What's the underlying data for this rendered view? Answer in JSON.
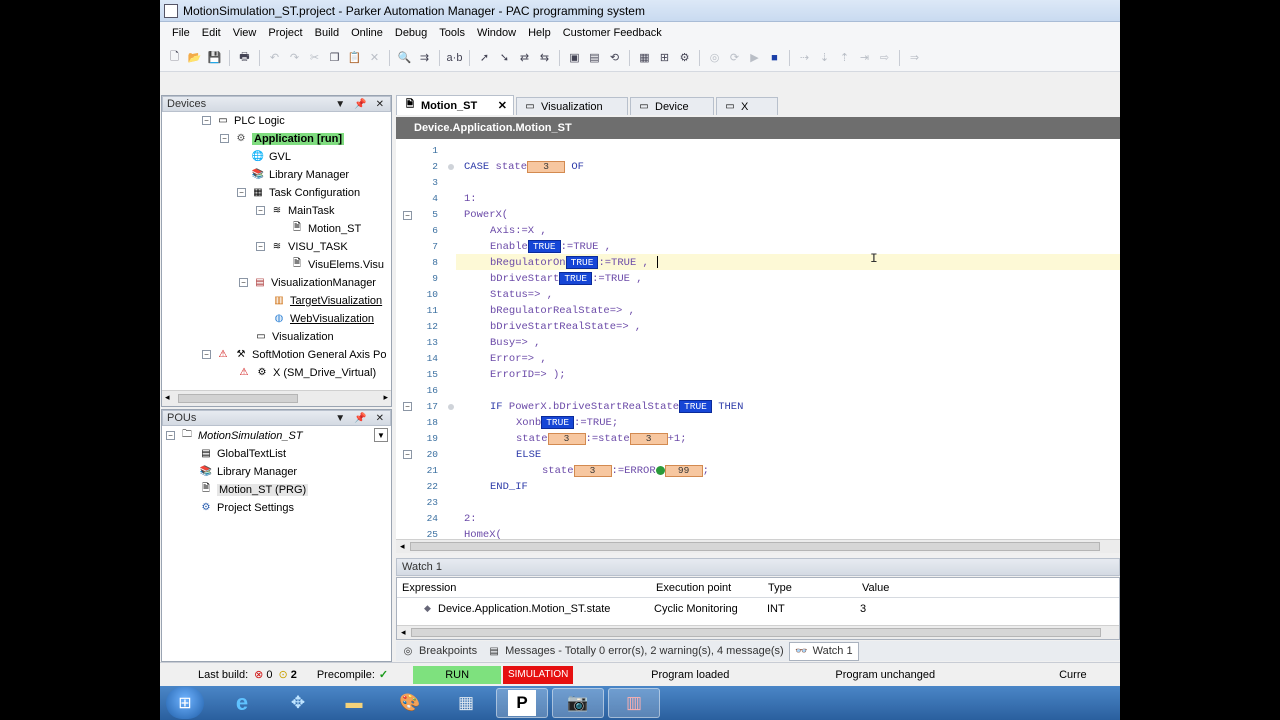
{
  "window": {
    "title": "MotionSimulation_ST.project - Parker Automation Manager - PAC programming system"
  },
  "menu": [
    "File",
    "Edit",
    "View",
    "Project",
    "Build",
    "Online",
    "Debug",
    "Tools",
    "Window",
    "Help",
    "Customer Feedback"
  ],
  "devices_panel": {
    "title": "Devices",
    "rows": [
      {
        "label": "PLC Logic",
        "icon": "plc-logic-icon"
      },
      {
        "label": "Application [run]",
        "icon": "application-gear-icon"
      },
      {
        "label": "GVL",
        "icon": "gvl-globe-icon"
      },
      {
        "label": "Library Manager",
        "icon": "library-books-icon"
      },
      {
        "label": "Task Configuration",
        "icon": "task-config-icon"
      },
      {
        "label": "MainTask",
        "icon": "task-icon"
      },
      {
        "label": "Motion_ST",
        "icon": "pou-icon"
      },
      {
        "label": "VISU_TASK",
        "icon": "task-icon"
      },
      {
        "label": "VisuElems.Visu",
        "icon": "pou-icon"
      },
      {
        "label": "VisualizationManager",
        "icon": "visu-manager-icon"
      },
      {
        "label": "TargetVisualization",
        "icon": "target-visu-icon"
      },
      {
        "label": "WebVisualization",
        "icon": "web-visu-icon"
      },
      {
        "label": "Visualization",
        "icon": "visualization-icon"
      },
      {
        "label": "SoftMotion General Axis Po",
        "icon": "warning-triangle-icon"
      },
      {
        "label": "X (SM_Drive_Virtual)",
        "icon": "axis-drive-icon"
      }
    ]
  },
  "pous_panel": {
    "title": "POUs",
    "rows": [
      {
        "label": "MotionSimulation_ST"
      },
      {
        "label": "GlobalTextList"
      },
      {
        "label": "Library Manager"
      },
      {
        "label": "Motion_ST (PRG)"
      },
      {
        "label": "Project Settings"
      }
    ]
  },
  "editor": {
    "tabs": [
      "Motion_ST",
      "Visualization",
      "Device",
      "X"
    ],
    "path": "Device.Application.Motion_ST",
    "lines": [
      {
        "n": "1",
        "code": ""
      },
      {
        "n": "2",
        "code": "CASE state [3] OF"
      },
      {
        "n": "3",
        "code": ""
      },
      {
        "n": "4",
        "code": "1:"
      },
      {
        "n": "5",
        "code": "PowerX("
      },
      {
        "n": "6",
        "code": "Axis:=X ,"
      },
      {
        "n": "7",
        "code": "Enable [TRUE] :=TRUE ,"
      },
      {
        "n": "8",
        "code": "bRegulatorOn [TRUE] :=TRUE ,"
      },
      {
        "n": "9",
        "code": "bDriveStart [TRUE] :=TRUE ,"
      },
      {
        "n": "10",
        "code": "Status=> ,"
      },
      {
        "n": "11",
        "code": "bRegulatorRealState=> ,"
      },
      {
        "n": "12",
        "code": "bDriveStartRealState=> ,"
      },
      {
        "n": "13",
        "code": "Busy=> ,"
      },
      {
        "n": "14",
        "code": "Error=> ,"
      },
      {
        "n": "15",
        "code": "ErrorID=> );"
      },
      {
        "n": "16",
        "code": ""
      },
      {
        "n": "17",
        "code": "IF PowerX.bDriveStartRealState [TRUE] THEN"
      },
      {
        "n": "18",
        "code": "Xonb [TRUE] :=TRUE;"
      },
      {
        "n": "19",
        "code": "state [3] :=state [3] +1;"
      },
      {
        "n": "20",
        "code": "ELSE"
      },
      {
        "n": "21",
        "code": "state [3] :=ERROR [99] ;"
      },
      {
        "n": "22",
        "code": "END_IF"
      },
      {
        "n": "23",
        "code": ""
      },
      {
        "n": "24",
        "code": "2:"
      },
      {
        "n": "25",
        "code": "HomeX("
      }
    ],
    "inline": {
      "true": "TRUE",
      "three": "3",
      "ninety_nine": "99"
    },
    "tokens": {
      "case": "CASE",
      "state": "state",
      "of": "OF",
      "one": "1:",
      "powerx": "PowerX(",
      "axis": "Axis:=X ,",
      "enable": "Enable",
      ":=true_comma": ":=TRUE ,",
      "breg": "bRegulatorOn",
      "bdrive": "bDriveStart",
      "status": "Status=> ,",
      "bregreal": "bRegulatorRealState=> ,",
      "bdrivereal": "bDriveStartRealState=> ,",
      "busy": "Busy=> ,",
      "error": "Error=> ,",
      "errorid": "ErrorID=> );",
      "if": "IF",
      "ifexpr": "PowerX.bDriveStartRealState",
      "then": "THEN",
      "xonb": "Xonb",
      "assign_true_semi": ":=TRUE;",
      "assign_state": ":=state",
      "plus1": "+1;",
      "else": "ELSE",
      "assign_error": ":=ERROR",
      "semi": ";",
      "endif": "END_IF",
      "two": "2:",
      "homex": "HomeX("
    }
  },
  "watch": {
    "title": "Watch 1",
    "columns": [
      "Expression",
      "Execution point",
      "Type",
      "Value"
    ],
    "rows": [
      {
        "expression": "Device.Application.Motion_ST.state",
        "execution_point": "Cyclic Monitoring",
        "type": "INT",
        "value": "3"
      }
    ]
  },
  "bottom_tabs": [
    "Breakpoints",
    "Messages - Totally 0 error(s), 2 warning(s), 4 message(s)",
    "Watch 1"
  ],
  "status": {
    "last_build": "Last build:",
    "errors": "0",
    "warnings": "2",
    "precompile": "Precompile:",
    "run": "RUN",
    "simulation": "SIMULATION",
    "program_loaded": "Program loaded",
    "program_unchanged": "Program unchanged",
    "current_user": "Curre"
  },
  "colors": {
    "run": "#7ee17e",
    "simulation": "#e61010",
    "application_highlight": "#7fdc7f",
    "true_box": "#1646d6",
    "int_box": "#f7c7a0"
  }
}
